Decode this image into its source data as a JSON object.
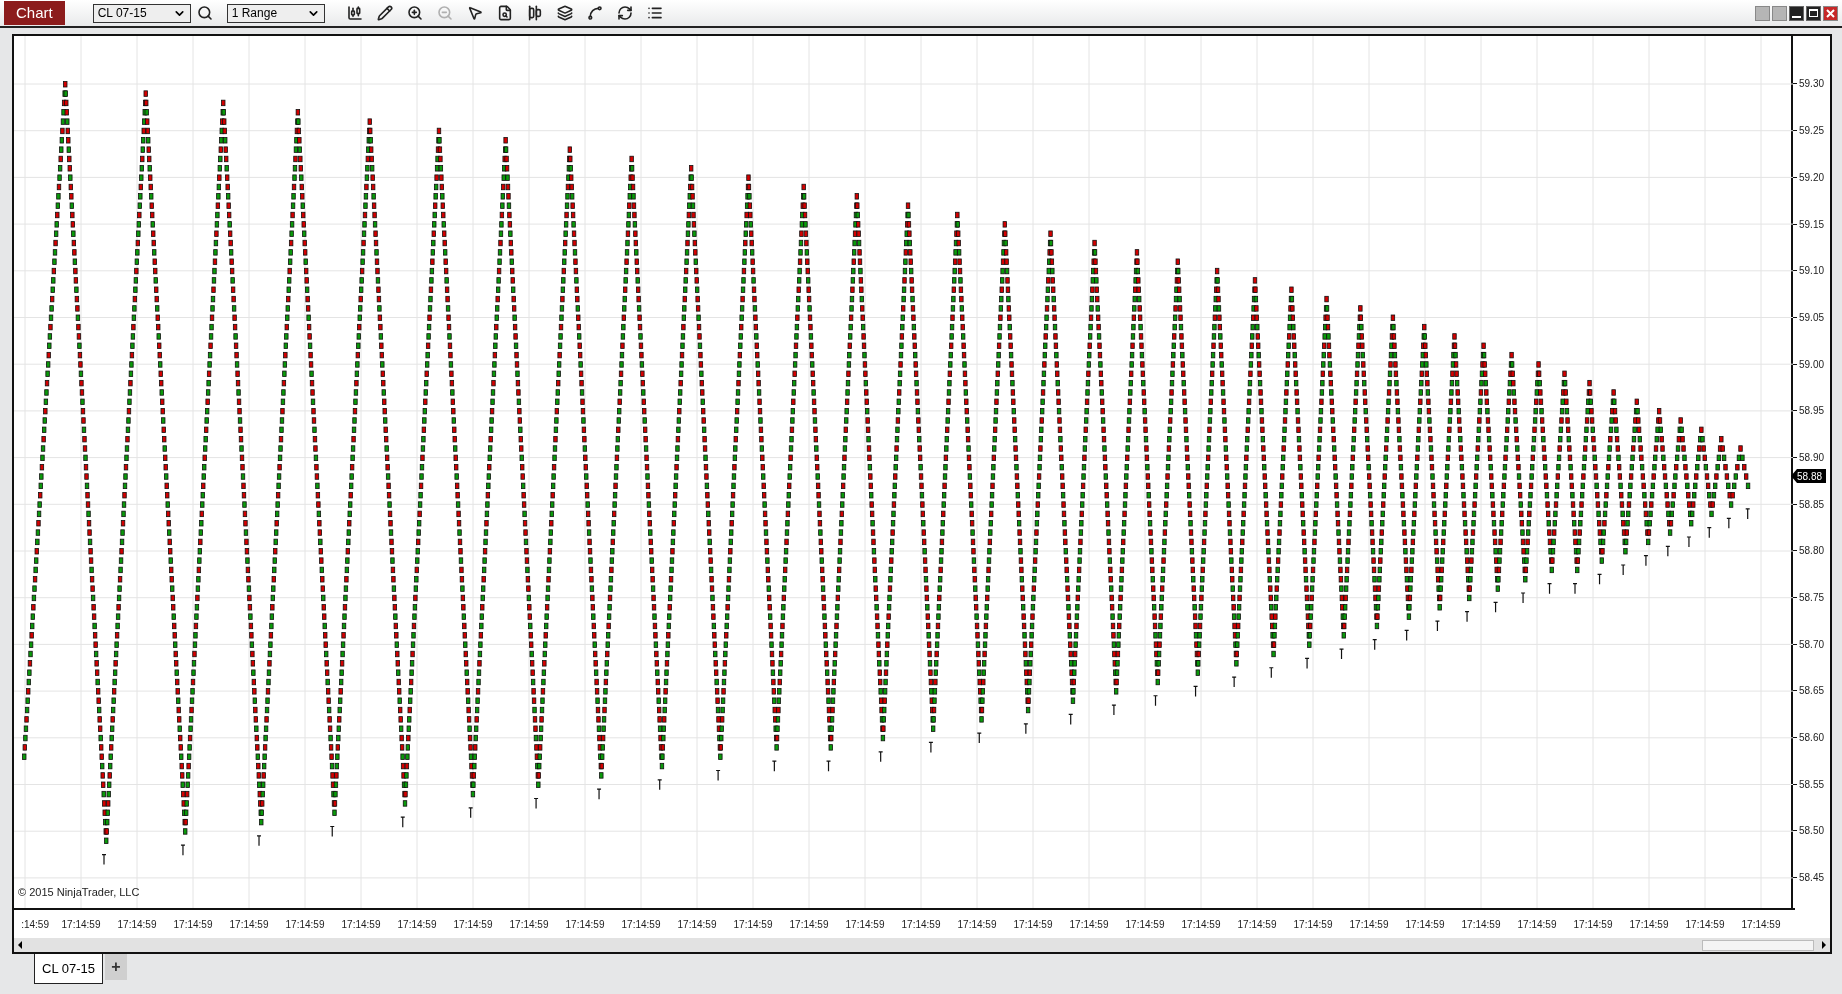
{
  "toolbar": {
    "title": "Chart",
    "instrument": "CL 07-15",
    "interval": "1 Range"
  },
  "chart": {
    "copyright": "© 2015 NinjaTrader, LLC",
    "current_price": "58.88",
    "price_axis": [
      "59.30",
      "59.25",
      "59.20",
      "59.15",
      "59.10",
      "59.05",
      "59.00",
      "58.95",
      "58.90",
      "58.85",
      "58.80",
      "58.75",
      "58.70",
      "58.65",
      "58.60",
      "58.55",
      "58.50",
      "58.45"
    ],
    "time_axis": [
      ":14:59",
      "17:14:59",
      "17:14:59",
      "17:14:59",
      "17:14:59",
      "17:14:59",
      "17:14:59",
      "17:14:59",
      "17:14:59",
      "17:14:59",
      "17:14:59",
      "17:14:59",
      "17:14:59",
      "17:14:59",
      "17:14:59",
      "17:14:59",
      "17:14:59",
      "17:14:59",
      "17:14:59",
      "17:14:59",
      "17:14:59",
      "17:14:59",
      "17:14:59",
      "17:14:59",
      "17:14:59",
      "17:14:59",
      "17:14:59",
      "17:14:59",
      "17:14:59",
      "17:14:59",
      "17:14:59",
      "17:14:59"
    ]
  },
  "tabs": [
    {
      "label": "CL 07-15",
      "selected": true
    }
  ],
  "add_tab": "+"
}
